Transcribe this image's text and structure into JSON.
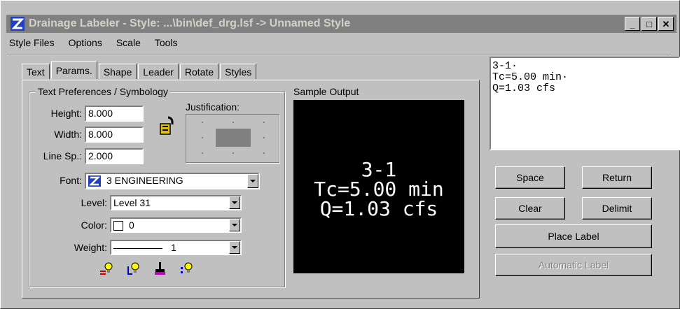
{
  "window": {
    "title": "Drainage Labeler - Style: ...\\bin\\def_drg.lsf -> Unnamed Style",
    "controls": {
      "minimize": "_",
      "maximize": "□",
      "close": "✕"
    }
  },
  "menu": [
    {
      "label": "Style Files"
    },
    {
      "label": "Options"
    },
    {
      "label": "Scale"
    },
    {
      "label": "Tools"
    }
  ],
  "tabs": [
    "Text",
    "Params.",
    "Shape",
    "Leader",
    "Rotate",
    "Styles"
  ],
  "active_tab": "Params.",
  "group": {
    "title": "Text Preferences / Symbology",
    "height_label": "Height:",
    "height_value": "8.000",
    "width_label": "Width:",
    "width_value": "8.000",
    "linesp_label": "Line Sp.:",
    "linesp_value": "2.000",
    "justification_label": "Justification:",
    "font_label": "Font:",
    "font_value": "3 ENGINEERING",
    "level_label": "Level:",
    "level_value": "Level 31",
    "color_label": "Color:",
    "color_value": "0",
    "weight_label": "Weight:",
    "weight_value": "1"
  },
  "sample": {
    "title": "Sample Output",
    "lines": [
      "3-1",
      "Tc=5.00 min",
      "Q=1.03 cfs"
    ]
  },
  "editor": {
    "lines": [
      "3-1·",
      "Tc=5.00 min·",
      "Q=1.03 cfs"
    ]
  },
  "buttons": {
    "space": "Space",
    "return": "Return",
    "clear": "Clear",
    "delimit": "Delimit",
    "place_label": "Place Label",
    "automatic_label": "Automatic Label"
  },
  "icons": [
    "lock-icon",
    "highlight-bulb-icon",
    "leader-bulb-icon",
    "paintbrush-icon",
    "dots-bulb-icon"
  ],
  "colors": {
    "titlebar": "#808080",
    "sample_bg": "#000000",
    "icon_yellow": "#ffff00",
    "icon_magenta": "#c000c0"
  }
}
